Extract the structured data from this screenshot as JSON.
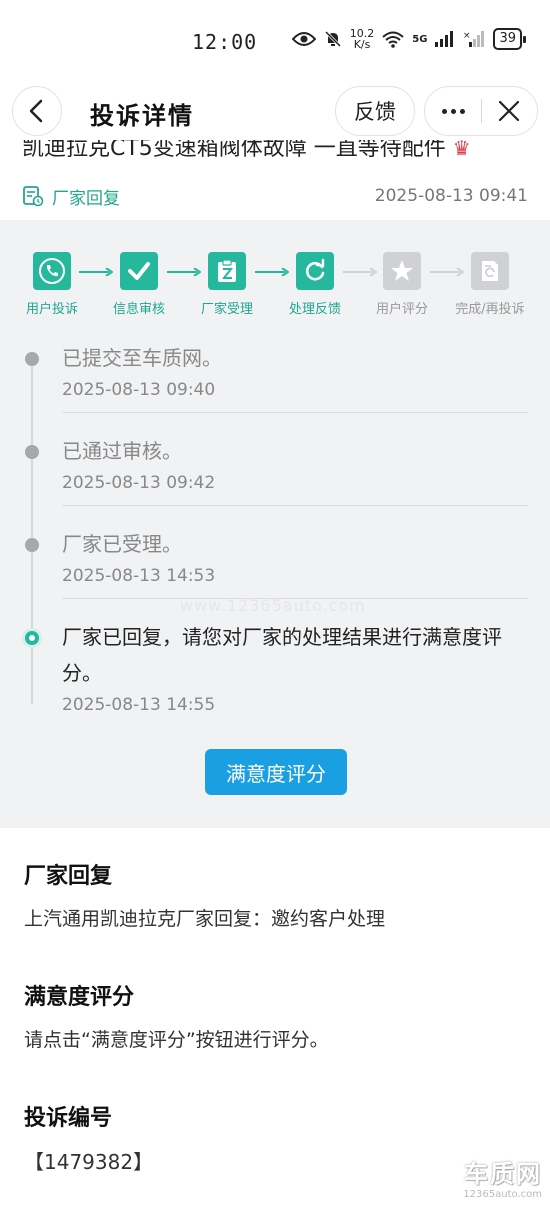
{
  "status_bar": {
    "time": "12:00",
    "net_speed_value": "10.2",
    "net_speed_unit": "K/s",
    "signal_label": "5G",
    "battery": "39"
  },
  "header": {
    "title": "投诉详情",
    "feedback_label": "反馈"
  },
  "complaint_title": "凯迪拉克CT5变速箱阀体故障 一直等待配件",
  "reply": {
    "label": "厂家回复",
    "time": "2025-08-13 09:41"
  },
  "steps": [
    {
      "label": "用户投诉",
      "icon": "phone-icon",
      "done": true
    },
    {
      "label": "信息审核",
      "icon": "check-icon",
      "done": true
    },
    {
      "label": "厂家受理",
      "icon": "clipboard-icon",
      "done": true
    },
    {
      "label": "处理反馈",
      "icon": "refresh-icon",
      "done": true
    },
    {
      "label": "用户评分",
      "icon": "star-icon",
      "done": false
    },
    {
      "label": "完成/再投诉",
      "icon": "document-icon",
      "done": false
    }
  ],
  "timeline": [
    {
      "text": "已提交至车质网。",
      "time": "2025-08-13 09:40"
    },
    {
      "text": "已通过审核。",
      "time": "2025-08-13 09:42"
    },
    {
      "text": "厂家已受理。",
      "time": "2025-08-13 14:53"
    },
    {
      "text": "厂家已回复，请您对厂家的处理结果进行满意度评分。",
      "time": "2025-08-13 14:55"
    }
  ],
  "watermark": "www.12365auto.com",
  "rate_button": "满意度评分",
  "sections": {
    "manufacturer_reply": {
      "title": "厂家回复",
      "body": "上汽通用凯迪拉克厂家回复：邀约客户处理"
    },
    "satisfaction": {
      "title": "满意度评分",
      "body": "请点击“满意度评分”按钮进行评分。"
    },
    "complaint_number": {
      "title": "投诉编号",
      "body": "【1479382】"
    }
  },
  "corner_logo": {
    "text": "车质网",
    "url": "12365auto.com"
  },
  "colors": {
    "accent_green": "#25b89c",
    "button_blue": "#1a9fe3",
    "panel_bg": "#f1f2f4"
  }
}
